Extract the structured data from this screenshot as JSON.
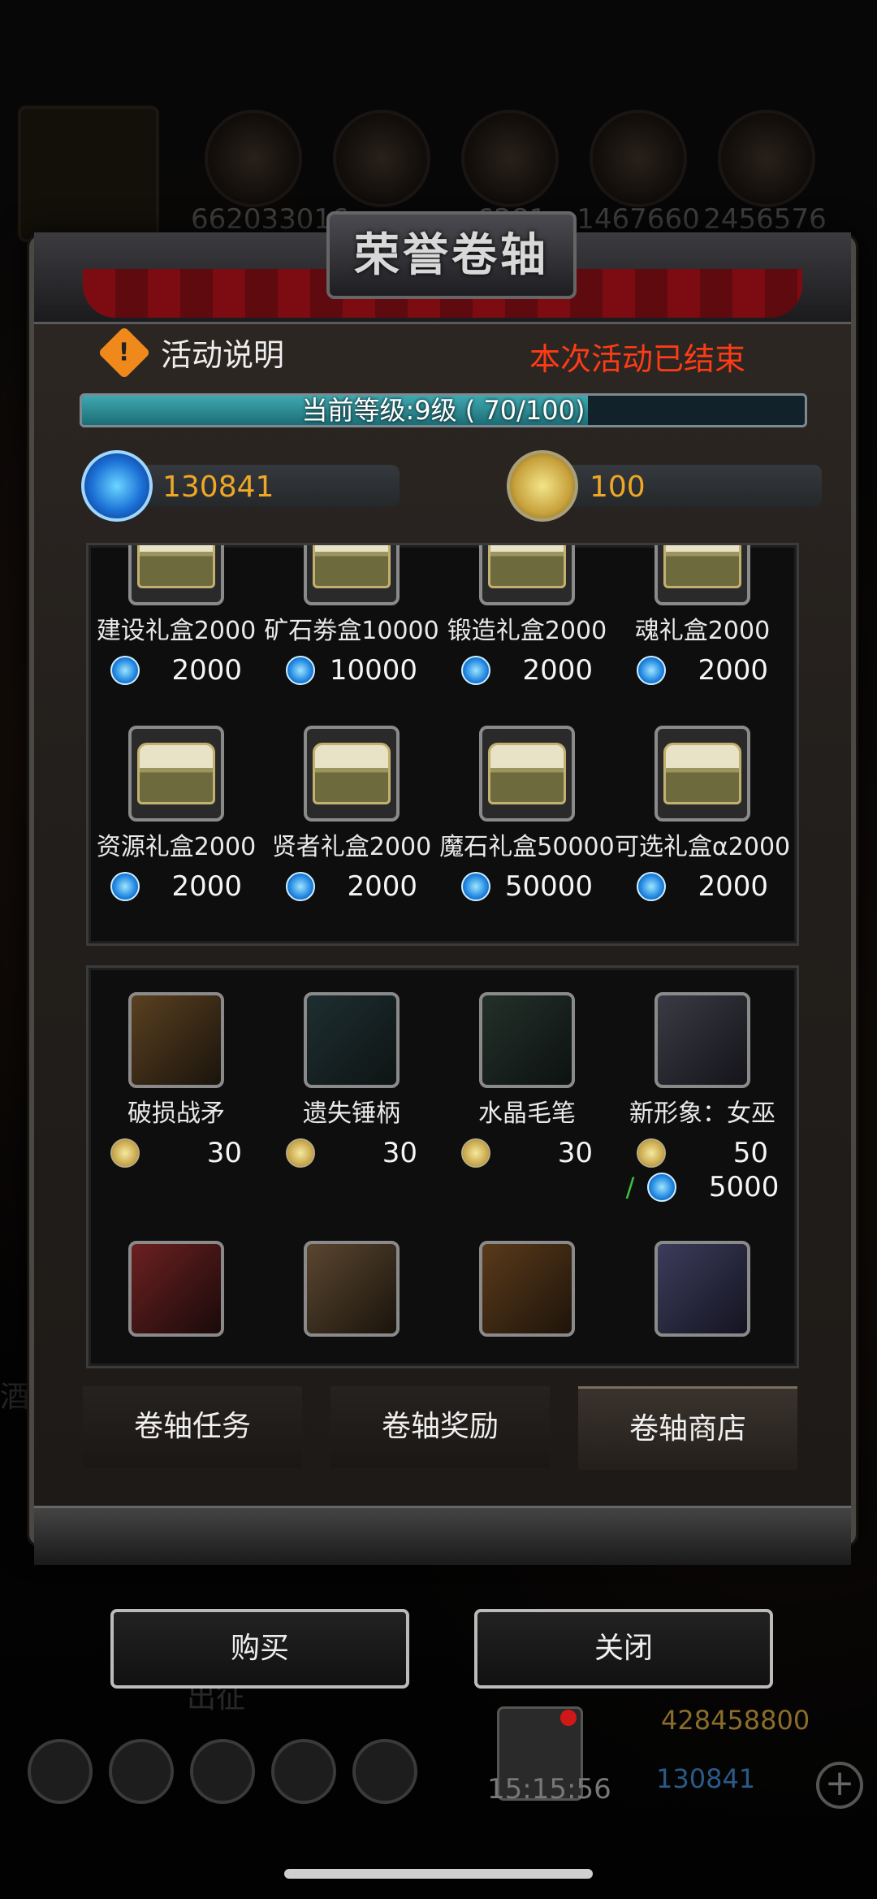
{
  "background": {
    "resource_values": [
      "662033016",
      "",
      "",
      "6281",
      "1467660",
      "2456576"
    ],
    "side_label": "出征",
    "left_label": "酒",
    "hud": {
      "time": "15:15:56",
      "gold": "428458800",
      "gems": "130841"
    }
  },
  "modal": {
    "title": "荣誉卷轴",
    "info_label": "活动说明",
    "status": "本次活动已结束",
    "level_text": "当前等级:9级 ( 70/100)",
    "level_progress": 0.7,
    "gem_balance": "130841",
    "coin_balance": "100",
    "gem_items": [
      {
        "name": "建设礼盒2000",
        "price": "2000"
      },
      {
        "name": "矿石劵盒10000",
        "price": "10000"
      },
      {
        "name": "锻造礼盒2000",
        "price": "2000"
      },
      {
        "name": "魂礼盒2000",
        "price": "2000"
      },
      {
        "name": "资源礼盒2000",
        "price": "2000"
      },
      {
        "name": "贤者礼盒2000",
        "price": "2000"
      },
      {
        "name": "魔石礼盒50000",
        "price": "50000"
      },
      {
        "name": "可选礼盒α2000",
        "price": "2000"
      }
    ],
    "coin_items": [
      {
        "name": "破损战矛",
        "price": "30",
        "icon": "spear-icon"
      },
      {
        "name": "遗失锤柄",
        "price": "30",
        "icon": "hammer-icon"
      },
      {
        "name": "水晶毛笔",
        "price": "30",
        "icon": "brush-icon"
      },
      {
        "name": "新形象：女巫",
        "price": "50",
        "alt_price": "5000",
        "icon": "witch-portrait-icon"
      }
    ],
    "tabs": [
      "卷轴任务",
      "卷轴奖励",
      "卷轴商店"
    ],
    "active_tab": 2
  },
  "buttons": {
    "buy": "购买",
    "close": "关闭"
  },
  "colors": {
    "status_red": "#ff3b16",
    "currency_orange": "#f0a726",
    "level_fill": "#3fa8b0"
  }
}
